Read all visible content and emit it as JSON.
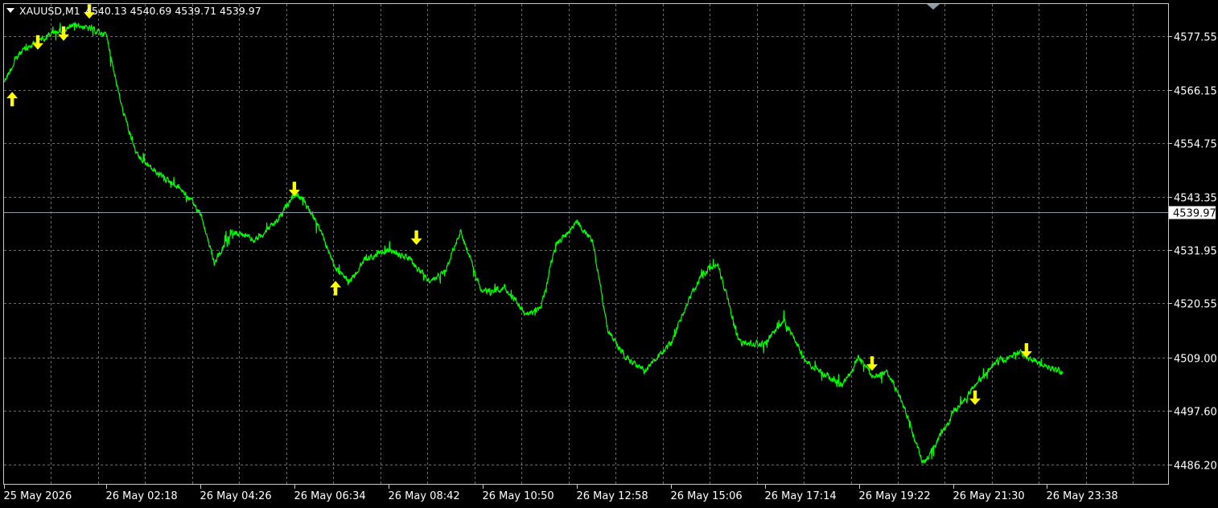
{
  "header": {
    "symbol": "XAUUSD,M1",
    "ohlc": "4540.13 4540.69 4539.71 4539.97"
  },
  "colors": {
    "background": "#000000",
    "line": "#00ff00",
    "grid": "#6b6b6b",
    "text": "#ffffff",
    "arrow": "#ffff00",
    "current_price_line": "#8a9aa6"
  },
  "chart_data": {
    "type": "line",
    "title": "",
    "xlabel": "",
    "ylabel": "",
    "grid": true,
    "ylim": [
      4482.0,
      4584.5
    ],
    "y_ticks": [
      "4577.55",
      "4566.15",
      "4554.75",
      "4543.35",
      "4531.95",
      "4520.55",
      "4509.00",
      "4497.60",
      "4486.20"
    ],
    "x_ticks": [
      "25 May 2026",
      "26 May 02:18",
      "26 May 04:26",
      "26 May 06:34",
      "26 May 08:42",
      "26 May 10:50",
      "26 May 12:58",
      "26 May 15:06",
      "26 May 17:14",
      "26 May 19:22",
      "26 May 21:30",
      "26 May 23:38"
    ],
    "current_price": 4539.97,
    "current_price_label": "4539.97",
    "series": [
      {
        "x": [
          "25 May 2026",
          "26 May 00:20",
          "26 May 01:00",
          "26 May 01:40",
          "26 May 02:18",
          "26 May 02:40",
          "26 May 03:00",
          "26 May 03:30",
          "26 May 04:00",
          "26 May 04:26",
          "26 May 04:45",
          "26 May 05:10",
          "26 May 05:40",
          "26 May 06:10",
          "26 May 06:34",
          "26 May 06:50",
          "26 May 07:10",
          "26 May 07:30",
          "26 May 07:50",
          "26 May 08:10",
          "26 May 08:42",
          "26 May 09:10",
          "26 May 09:40",
          "26 May 10:00",
          "26 May 10:20",
          "26 May 10:50",
          "26 May 11:20",
          "26 May 11:50",
          "26 May 12:10",
          "26 May 12:30",
          "26 May 12:58",
          "26 May 13:20",
          "26 May 13:40",
          "26 May 14:00",
          "26 May 14:30",
          "26 May 15:06",
          "26 May 15:30",
          "26 May 15:50",
          "26 May 16:10",
          "26 May 16:40",
          "26 May 17:14",
          "26 May 17:40",
          "26 May 18:10",
          "26 May 18:40",
          "26 May 19:00",
          "26 May 19:22",
          "26 May 19:40",
          "26 May 20:00",
          "26 May 20:20",
          "26 May 20:50",
          "26 May 21:30",
          "26 May 22:00",
          "26 May 22:30",
          "26 May 23:00",
          "26 May 23:38",
          "26 May 23:59"
        ],
        "y": [
          4568.0,
          4574.0,
          4578.0,
          4580.0,
          4578.0,
          4562.0,
          4552.0,
          4548.0,
          4545.0,
          4540.0,
          4529.0,
          4536.0,
          4534.0,
          4538.0,
          4544.0,
          4542.0,
          4536.0,
          4528.0,
          4525.0,
          4530.0,
          4532.0,
          4530.0,
          4525.0,
          4528.0,
          4536.0,
          4523.0,
          4524.0,
          4518.0,
          4520.0,
          4533.0,
          4538.0,
          4534.0,
          4515.0,
          4510.0,
          4506.0,
          4512.0,
          4521.0,
          4527.0,
          4529.0,
          4512.0,
          4512.0,
          4517.0,
          4508.0,
          4505.0,
          4503.0,
          4509.0,
          4505.0,
          4506.0,
          4500.0,
          4486.0,
          4497.0,
          4503.0,
          4508.0,
          4510.0,
          4507.0,
          4506.0
        ]
      }
    ],
    "annotations": [
      {
        "x": "26 May 00:10",
        "y": 4564.2,
        "label": "up-arrow"
      },
      {
        "x": "26 May 00:45",
        "y": 4576.3,
        "label": "down-arrow"
      },
      {
        "x": "26 May 01:20",
        "y": 4578.2,
        "label": "down-arrow"
      },
      {
        "x": "26 May 01:55",
        "y": 4582.9,
        "label": "down-arrow"
      },
      {
        "x": "26 May 06:34",
        "y": 4545.0,
        "label": "down-arrow"
      },
      {
        "x": "26 May 07:30",
        "y": 4523.8,
        "label": "up-arrow"
      },
      {
        "x": "26 May 09:20",
        "y": 4534.6,
        "label": "down-arrow"
      },
      {
        "x": "26 May 19:40",
        "y": 4507.7,
        "label": "down-arrow"
      },
      {
        "x": "26 May 22:00",
        "y": 4500.4,
        "label": "down-arrow"
      },
      {
        "x": "26 May 23:10",
        "y": 4510.5,
        "label": "down-arrow"
      }
    ]
  }
}
